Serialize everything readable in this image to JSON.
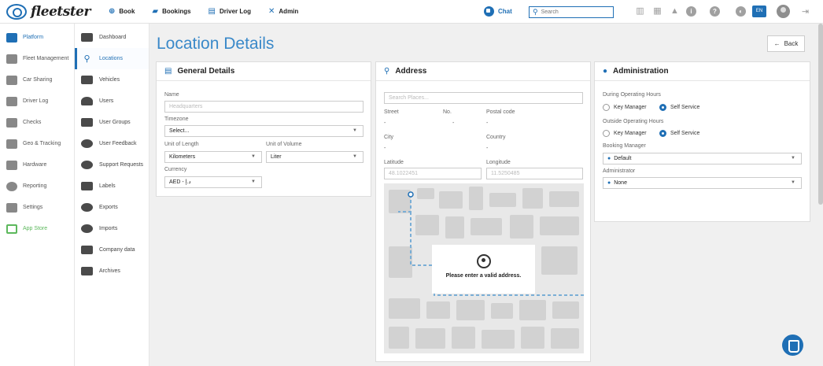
{
  "header": {
    "logo": "fleetster",
    "nav": [
      {
        "label": "Book",
        "icon": "plus-circle-icon"
      },
      {
        "label": "Bookings",
        "icon": "car-icon"
      },
      {
        "label": "Driver Log",
        "icon": "clipboard-icon"
      },
      {
        "label": "Admin",
        "icon": "wrench-icon"
      }
    ],
    "chat": "Chat",
    "search_placeholder": "Search",
    "lang": "EN"
  },
  "sidebar_primary": [
    {
      "label": "Platform",
      "icon": "clipboard-icon",
      "active": true
    },
    {
      "label": "Fleet Management",
      "icon": "truck-icon"
    },
    {
      "label": "Car Sharing",
      "icon": "car-share-icon"
    },
    {
      "label": "Driver Log",
      "icon": "logbook-icon"
    },
    {
      "label": "Checks",
      "icon": "checklist-icon"
    },
    {
      "label": "Geo & Tracking",
      "icon": "map-icon"
    },
    {
      "label": "Hardware",
      "icon": "gear-icon"
    },
    {
      "label": "Reporting",
      "icon": "pie-chart-icon"
    },
    {
      "label": "Settings",
      "icon": "cog-icon"
    },
    {
      "label": "App Store",
      "icon": "store-icon"
    }
  ],
  "sidebar_secondary": [
    {
      "label": "Dashboard"
    },
    {
      "label": "Locations",
      "active": true
    },
    {
      "label": "Vehicles"
    },
    {
      "label": "Users"
    },
    {
      "label": "User Groups"
    },
    {
      "label": "User Feedback"
    },
    {
      "label": "Support Requests"
    },
    {
      "label": "Labels"
    },
    {
      "label": "Exports"
    },
    {
      "label": "Imports"
    },
    {
      "label": "Company data"
    },
    {
      "label": "Archives"
    }
  ],
  "page": {
    "title": "Location Details",
    "back": "Back"
  },
  "general": {
    "title": "General Details",
    "name_label": "Name",
    "name_placeholder": "Headquarters",
    "timezone_label": "Timezone",
    "timezone_value": "Select...",
    "length_label": "Unit of Length",
    "length_value": "Kilometers",
    "volume_label": "Unit of Volume",
    "volume_value": "Liter",
    "currency_label": "Currency",
    "currency_value": "AED - د.إ"
  },
  "address": {
    "title": "Address",
    "search_placeholder": "Search Places...",
    "street_label": "Street",
    "street_value": "-",
    "no_label": "No.",
    "no_value": "-",
    "postal_label": "Postal code",
    "postal_value": "-",
    "city_label": "City",
    "city_value": "-",
    "country_label": "Country",
    "country_value": "-",
    "lat_label": "Latitude",
    "lat_placeholder": "48.1022451",
    "lng_label": "Longitude",
    "lng_placeholder": "11.5250485",
    "map_message": "Please enter a valid address."
  },
  "admin": {
    "title": "Administration",
    "during_label": "During Operating Hours",
    "outside_label": "Outside Operating Hours",
    "opt_key": "Key Manager",
    "opt_self": "Self Service",
    "booking_label": "Booking Manager",
    "booking_value": "Default",
    "admin_label": "Administrator",
    "admin_value": "None"
  }
}
